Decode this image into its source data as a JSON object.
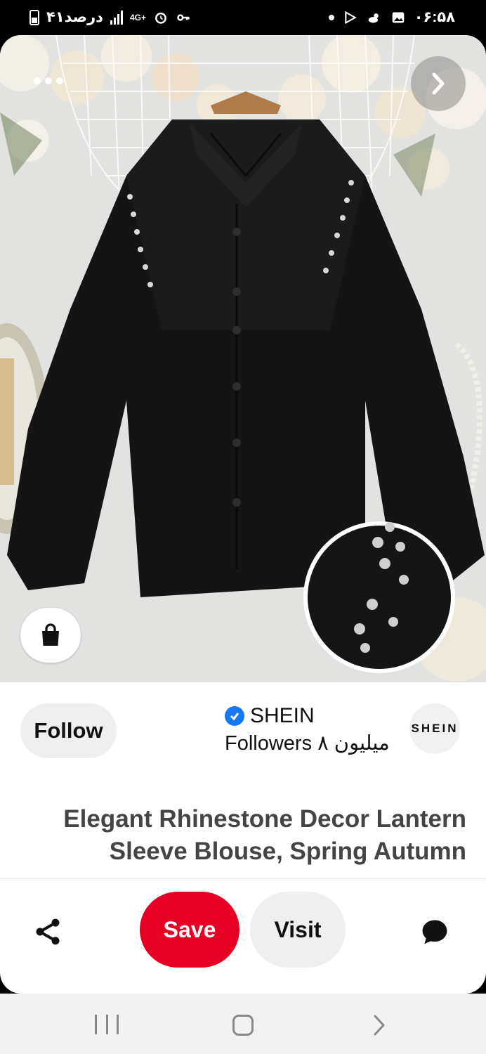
{
  "status_bar": {
    "time": "۰۶:۵۸",
    "battery": "۴۱درصد",
    "network": "4G+"
  },
  "pin": {
    "brand": {
      "name": "SHEIN",
      "followers": "Followers ۸ میلیون",
      "avatar_text": "SHEIN",
      "verified": true
    },
    "follow_label": "Follow",
    "title_line1": "Elegant Rhinestone Decor Lantern",
    "title_line2": "Sleeve Blouse, Spring Autumn",
    "image_description": "black blouse with rhinestone shoulder detail"
  },
  "actions": {
    "save_label": "Save",
    "visit_label": "Visit"
  },
  "colors": {
    "save": "#e60023",
    "verified": "#1877f2",
    "pill_bg": "#efefef"
  },
  "icons": [
    "share-icon",
    "comment-icon",
    "shopping-bag-icon",
    "chevron-right-icon",
    "more-dots-icon",
    "verified-icon"
  ]
}
